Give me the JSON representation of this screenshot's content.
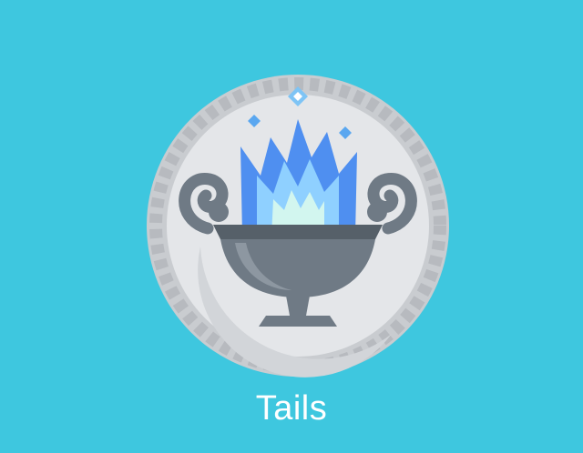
{
  "coin": {
    "face": "tails",
    "icon": "flaming-brazier-icon",
    "result_label": "Tails"
  },
  "colors": {
    "background": "#3ec7df",
    "coin_silver": "#dadde1",
    "coin_rim": "#b9bcc1",
    "brazier": "#6f7a85",
    "flame_outer": "#4f8ff0",
    "flame_inner": "#8fd0ff",
    "flame_core": "#d2f6ef",
    "label": "#ffffff"
  }
}
